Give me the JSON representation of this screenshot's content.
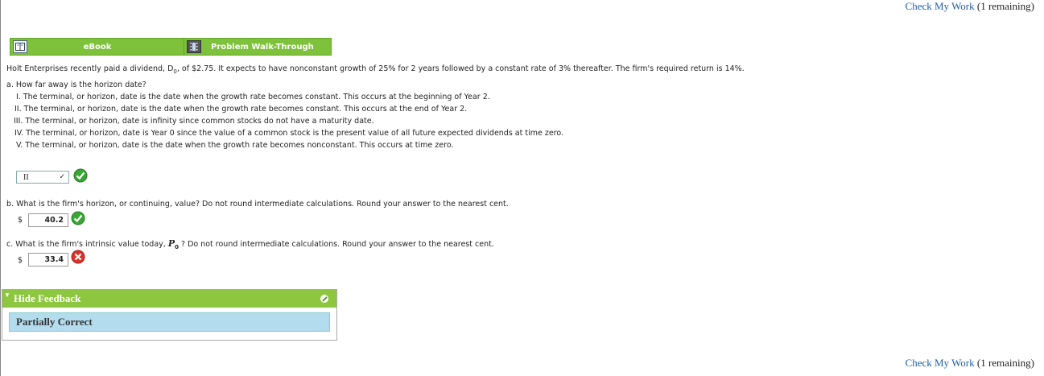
{
  "check_my_work": {
    "link_label": "Check My Work",
    "remaining_label": "(1 remaining)"
  },
  "toolbar": {
    "ebook_label": "eBook",
    "walkthrough_label": "Problem Walk-Through"
  },
  "problem": {
    "intro_prefix": "Holt Enterprises recently paid a dividend, D",
    "intro_sub": "0",
    "intro_suffix": ", of $2.75. It expects to have nonconstant growth of 25% for 2 years followed by a constant rate of 3% thereafter. The firm's required return is 14%."
  },
  "part_a": {
    "question": "a. How far away is the horizon date?",
    "options": [
      "I. The terminal, or horizon, date is the date when the growth rate becomes constant. This occurs at the beginning of Year 2.",
      "II. The terminal, or horizon, date is the date when the growth rate becomes constant. This occurs at the end of Year 2.",
      "III. The terminal, or horizon, date is infinity since common stocks do not have a maturity date.",
      "IV. The terminal, or horizon, date is Year 0 since the value of a common stock is the present value of all future expected dividends at time zero.",
      "V. The terminal, or horizon, date is the date when the growth rate becomes nonconstant. This occurs at time zero."
    ],
    "selected": "II",
    "status": "correct"
  },
  "part_b": {
    "question": "b. What is the firm's horizon, or continuing, value? Do not round intermediate calculations. Round your answer to the nearest cent.",
    "currency": "$",
    "answer": "40.2",
    "status": "correct"
  },
  "part_c": {
    "question_prefix": "c. What is the firm's intrinsic value today, ",
    "symbol": "P",
    "symbol_sub": "0",
    "question_suffix": " ? Do not round intermediate calculations. Round your answer to the nearest cent.",
    "currency": "$",
    "answer": "33.4",
    "status": "incorrect"
  },
  "feedback": {
    "header": "Hide Feedback",
    "result": "Partially Correct"
  },
  "colors": {
    "accent_green": "#7ec13b",
    "correct": "#3aa635",
    "incorrect": "#d9342b",
    "link": "#1f5fa8"
  }
}
